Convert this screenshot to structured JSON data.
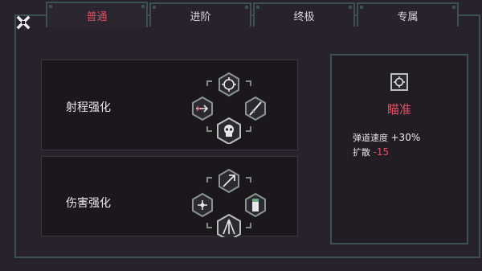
{
  "tabs": [
    {
      "label": "普通",
      "active": true
    },
    {
      "label": "进阶",
      "active": false
    },
    {
      "label": "终极",
      "active": false
    },
    {
      "label": "专属",
      "active": false
    }
  ],
  "panels": [
    {
      "title": "射程强化"
    },
    {
      "title": "伤害强化"
    }
  ],
  "detail": {
    "name": "瞄准",
    "stat1_label": "弹道速度",
    "stat1_value": "+30%",
    "stat2_label": "扩散",
    "stat2_value": "-15"
  },
  "colors": {
    "accent": "#e24f62",
    "frame": "#3b5156",
    "background": "#27222b",
    "panel": "#1b171d"
  },
  "icons": {
    "close": "close-x-icon",
    "aim": "crosshair-icon"
  }
}
